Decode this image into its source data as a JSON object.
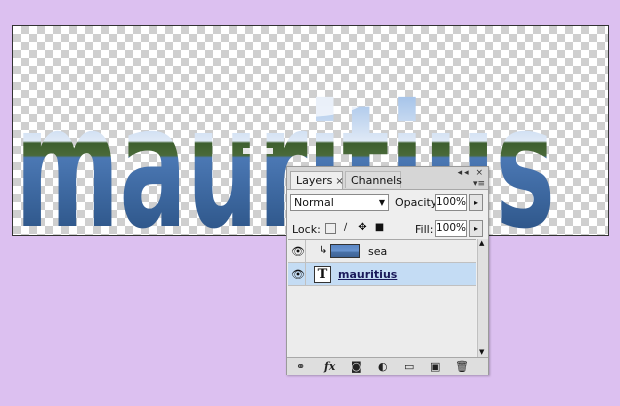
{
  "canvas": {
    "text": "mauritius"
  },
  "panel": {
    "tabs": [
      {
        "label": "Layers",
        "close": "×"
      },
      {
        "label": "Channels"
      }
    ],
    "window_controls": "◂◂ ×",
    "menu_icon": "▾≡",
    "blend_mode": "Normal",
    "opacity_label": "Opacity:",
    "opacity_value": "100%",
    "lock_label": "Lock:",
    "fill_label": "Fill:",
    "fill_value": "100%",
    "layers": [
      {
        "name": "sea",
        "type": "image",
        "clipped": true,
        "selected": false
      },
      {
        "name": "mauritius",
        "type": "text",
        "selected": true
      }
    ]
  },
  "icons": {
    "eye": "👁",
    "spin": "▸",
    "link": "⚭",
    "fx": "fx",
    "mask": "◙",
    "adjust": "◐",
    "folder": "▭",
    "new": "▣",
    "trash": "🗑"
  },
  "colors": {
    "background": "#dcc0f0",
    "selected_row": "#c4dcf4"
  }
}
